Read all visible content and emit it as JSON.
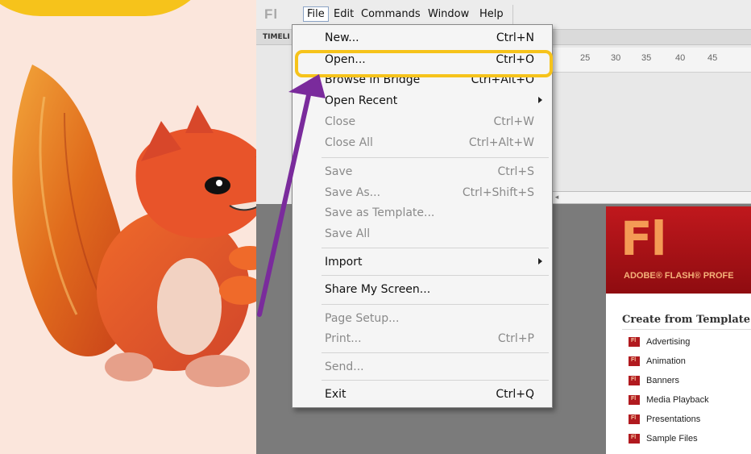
{
  "colors": {
    "highlight": "#f6c31b",
    "arrow": "#7a2b9c",
    "flash_red": "#b11a1f",
    "flash_logo": "#f49b55"
  },
  "app": {
    "logo": "Fl",
    "menu": [
      "File",
      "Edit",
      "Commands",
      "Window",
      "Help"
    ]
  },
  "timeline": {
    "label": "TIMELI",
    "ruler": [
      "25",
      "30",
      "35",
      "40",
      "45"
    ]
  },
  "file_menu": {
    "items": [
      {
        "label": "New...",
        "shortcut": "Ctrl+N",
        "disabled": false
      },
      {
        "label": "Open...",
        "shortcut": "Ctrl+O",
        "disabled": false,
        "highlighted": true
      },
      {
        "label": "Browse in Bridge",
        "shortcut": "Ctrl+Alt+O",
        "disabled": false
      },
      {
        "label": "Open Recent",
        "shortcut": "",
        "disabled": false,
        "submenu": true
      },
      {
        "label": "Close",
        "shortcut": "Ctrl+W",
        "disabled": true
      },
      {
        "label": "Close All",
        "shortcut": "Ctrl+Alt+W",
        "disabled": true
      },
      {
        "label": "Save",
        "shortcut": "Ctrl+S",
        "disabled": true
      },
      {
        "label": "Save As...",
        "shortcut": "Ctrl+Shift+S",
        "disabled": true
      },
      {
        "label": "Save as Template...",
        "shortcut": "",
        "disabled": true
      },
      {
        "label": "Save All",
        "shortcut": "",
        "disabled": true
      },
      {
        "label": "Import",
        "shortcut": "",
        "disabled": false,
        "submenu": true
      },
      {
        "label": "Share My Screen...",
        "shortcut": "",
        "disabled": false
      },
      {
        "label": "Page Setup...",
        "shortcut": "",
        "disabled": true
      },
      {
        "label": "Print...",
        "shortcut": "Ctrl+P",
        "disabled": true
      },
      {
        "label": "Send...",
        "shortcut": "",
        "disabled": true
      },
      {
        "label": "Exit",
        "shortcut": "Ctrl+Q",
        "disabled": false
      }
    ]
  },
  "welcome": {
    "logo": "Fl",
    "brand": "ADOBE® FLASH® PROFE",
    "create_heading": "Create from Template",
    "templates": [
      "Advertising",
      "Animation",
      "Banners",
      "Media Playback",
      "Presentations",
      "Sample Files"
    ]
  }
}
